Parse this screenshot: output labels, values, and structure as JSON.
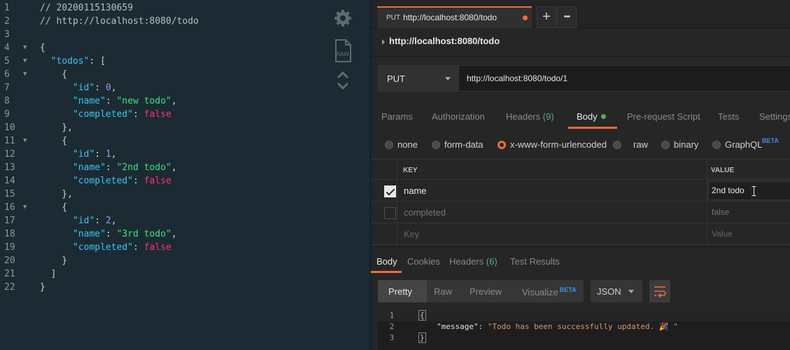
{
  "editor": {
    "lines": [
      {
        "n": "1",
        "fold": false,
        "tokens": [
          {
            "t": "// 20200115130659",
            "c": "com"
          }
        ]
      },
      {
        "n": "2",
        "fold": false,
        "tokens": [
          {
            "t": "// http://localhost:8080/todo",
            "c": "com"
          }
        ]
      },
      {
        "n": "3",
        "fold": false,
        "tokens": []
      },
      {
        "n": "4",
        "fold": true,
        "tokens": [
          {
            "t": "{",
            "c": "pun"
          }
        ]
      },
      {
        "n": "5",
        "fold": true,
        "tokens": [
          {
            "t": "  ",
            "c": "pun"
          },
          {
            "t": "\"todos\"",
            "c": "key"
          },
          {
            "t": ": [",
            "c": "pun"
          }
        ]
      },
      {
        "n": "6",
        "fold": true,
        "tokens": [
          {
            "t": "    {",
            "c": "pun"
          }
        ]
      },
      {
        "n": "7",
        "fold": false,
        "tokens": [
          {
            "t": "      ",
            "c": "pun"
          },
          {
            "t": "\"id\"",
            "c": "key"
          },
          {
            "t": ": ",
            "c": "pun"
          },
          {
            "t": "0",
            "c": "num"
          },
          {
            "t": ",",
            "c": "pun"
          }
        ]
      },
      {
        "n": "8",
        "fold": false,
        "tokens": [
          {
            "t": "      ",
            "c": "pun"
          },
          {
            "t": "\"name\"",
            "c": "key"
          },
          {
            "t": ": ",
            "c": "pun"
          },
          {
            "t": "\"new todo\"",
            "c": "str"
          },
          {
            "t": ",",
            "c": "pun"
          }
        ]
      },
      {
        "n": "9",
        "fold": false,
        "tokens": [
          {
            "t": "      ",
            "c": "pun"
          },
          {
            "t": "\"completed\"",
            "c": "key"
          },
          {
            "t": ": ",
            "c": "pun"
          },
          {
            "t": "false",
            "c": "bool"
          }
        ]
      },
      {
        "n": "10",
        "fold": false,
        "tokens": [
          {
            "t": "    },",
            "c": "pun"
          }
        ]
      },
      {
        "n": "11",
        "fold": true,
        "tokens": [
          {
            "t": "    {",
            "c": "pun"
          }
        ]
      },
      {
        "n": "12",
        "fold": false,
        "tokens": [
          {
            "t": "      ",
            "c": "pun"
          },
          {
            "t": "\"id\"",
            "c": "key"
          },
          {
            "t": ": ",
            "c": "pun"
          },
          {
            "t": "1",
            "c": "num"
          },
          {
            "t": ",",
            "c": "pun"
          }
        ]
      },
      {
        "n": "13",
        "fold": false,
        "tokens": [
          {
            "t": "      ",
            "c": "pun"
          },
          {
            "t": "\"name\"",
            "c": "key"
          },
          {
            "t": ": ",
            "c": "pun"
          },
          {
            "t": "\"2nd todo\"",
            "c": "str"
          },
          {
            "t": ",",
            "c": "pun"
          }
        ]
      },
      {
        "n": "14",
        "fold": false,
        "tokens": [
          {
            "t": "      ",
            "c": "pun"
          },
          {
            "t": "\"completed\"",
            "c": "key"
          },
          {
            "t": ": ",
            "c": "pun"
          },
          {
            "t": "false",
            "c": "bool"
          }
        ]
      },
      {
        "n": "15",
        "fold": false,
        "tokens": [
          {
            "t": "    },",
            "c": "pun"
          }
        ]
      },
      {
        "n": "16",
        "fold": true,
        "tokens": [
          {
            "t": "    {",
            "c": "pun"
          }
        ]
      },
      {
        "n": "17",
        "fold": false,
        "tokens": [
          {
            "t": "      ",
            "c": "pun"
          },
          {
            "t": "\"id\"",
            "c": "key"
          },
          {
            "t": ": ",
            "c": "pun"
          },
          {
            "t": "2",
            "c": "num"
          },
          {
            "t": ",",
            "c": "pun"
          }
        ]
      },
      {
        "n": "18",
        "fold": false,
        "tokens": [
          {
            "t": "      ",
            "c": "pun"
          },
          {
            "t": "\"name\"",
            "c": "key"
          },
          {
            "t": ": ",
            "c": "pun"
          },
          {
            "t": "\"3rd todo\"",
            "c": "str"
          },
          {
            "t": ",",
            "c": "pun"
          }
        ]
      },
      {
        "n": "19",
        "fold": false,
        "tokens": [
          {
            "t": "      ",
            "c": "pun"
          },
          {
            "t": "\"completed\"",
            "c": "key"
          },
          {
            "t": ": ",
            "c": "pun"
          },
          {
            "t": "false",
            "c": "bool"
          }
        ]
      },
      {
        "n": "20",
        "fold": false,
        "tokens": [
          {
            "t": "    }",
            "c": "pun"
          }
        ]
      },
      {
        "n": "21",
        "fold": false,
        "tokens": [
          {
            "t": "  ]",
            "c": "pun"
          }
        ]
      },
      {
        "n": "22",
        "fold": false,
        "tokens": [
          {
            "t": "}",
            "c": "pun"
          }
        ]
      }
    ],
    "side_icons": [
      "gear-icon",
      "raw-icon",
      "chevron-up-icon",
      "chevron-down-icon"
    ],
    "raw_label": "RAW"
  },
  "postman": {
    "tab": {
      "method": "PUT",
      "title": "http://localhost:8080/todo",
      "unsaved": true
    },
    "tab_buttons": {
      "add": "+",
      "more": "•••"
    },
    "request_name": "http://localhost:8080/todo",
    "method": "PUT",
    "url": "http://localhost:8080/todo/1",
    "request_tabs": [
      {
        "label": "Params"
      },
      {
        "label": "Authorization"
      },
      {
        "label": "Headers",
        "count": "(9)"
      },
      {
        "label": "Body",
        "active": true
      },
      {
        "label": "Pre-request Script"
      },
      {
        "label": "Tests"
      },
      {
        "label": "Settings"
      }
    ],
    "body_types": [
      {
        "label": "none",
        "selected": false
      },
      {
        "label": "form-data",
        "selected": false
      },
      {
        "label": "x-www-form-urlencoded",
        "selected": true
      },
      {
        "label": "raw",
        "selected": false
      },
      {
        "label": "binary",
        "selected": false
      },
      {
        "label": "GraphQL",
        "selected": false,
        "badge": "BETA"
      }
    ],
    "kv_headers": {
      "key": "KEY",
      "value": "VALUE"
    },
    "kv_rows": [
      {
        "checked": true,
        "key": "name",
        "value": "2nd todo",
        "placeholder": false
      },
      {
        "checked": false,
        "key": "completed",
        "value": "false",
        "placeholder": false
      },
      {
        "checked": null,
        "key": "Key",
        "value": "Value",
        "placeholder": true
      }
    ],
    "response_tabs": [
      {
        "label": "Body",
        "active": true
      },
      {
        "label": "Cookies"
      },
      {
        "label": "Headers",
        "count": "(6)"
      },
      {
        "label": "Test Results"
      }
    ],
    "view_modes": [
      {
        "label": "Pretty",
        "active": true
      },
      {
        "label": "Raw"
      },
      {
        "label": "Preview"
      },
      {
        "label": "Visualize",
        "badge": "BETA"
      }
    ],
    "format": "JSON",
    "response_lines": [
      {
        "n": "1",
        "text": "{"
      },
      {
        "n": "2",
        "key": "\"message\"",
        "sep": ": ",
        "value": "\"Todo has been successfully updated. 🎉 \""
      },
      {
        "n": "3",
        "text": "}"
      }
    ],
    "colors": {
      "accent": "#f26b3a",
      "green": "#4cb34c",
      "beta": "#3f8fe8"
    }
  }
}
